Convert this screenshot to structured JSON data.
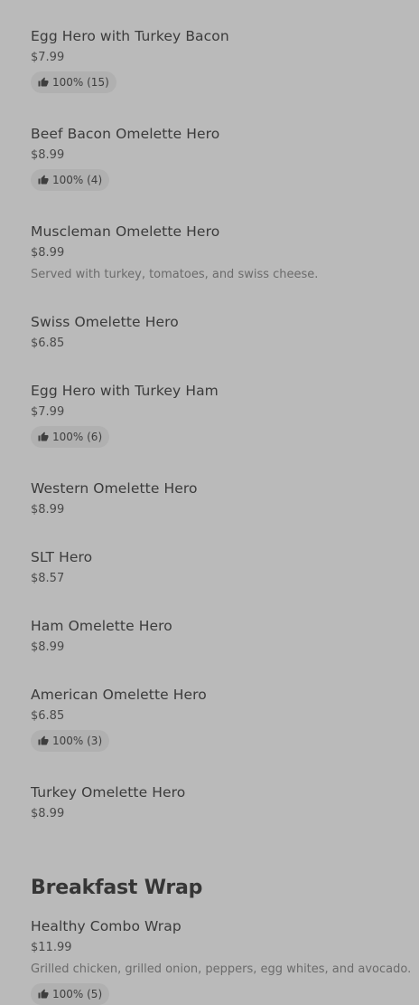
{
  "menu": {
    "section_title": "Breakfast Wrap",
    "items": [
      {
        "name": "Egg Hero with Turkey Bacon",
        "price": "$7.99",
        "rating": "100% (15)"
      },
      {
        "name": "Beef Bacon Omelette Hero",
        "price": "$8.99",
        "rating": "100% (4)"
      },
      {
        "name": "Muscleman Omelette Hero",
        "price": "$8.99",
        "description": "Served with turkey, tomatoes, and swiss cheese."
      },
      {
        "name": "Swiss Omelette Hero",
        "price": "$6.85"
      },
      {
        "name": "Egg Hero with Turkey Ham",
        "price": "$7.99",
        "rating": "100% (6)"
      },
      {
        "name": "Western Omelette Hero",
        "price": "$8.99"
      },
      {
        "name": "SLT Hero",
        "price": "$8.57"
      },
      {
        "name": "Ham Omelette Hero",
        "price": "$8.99"
      },
      {
        "name": "American Omelette Hero",
        "price": "$6.85",
        "rating": "100% (3)"
      },
      {
        "name": "Turkey Omelette Hero",
        "price": "$8.99"
      },
      {
        "name": "Healthy Combo Wrap",
        "price": "$11.99",
        "description": "Grilled chicken, grilled onion, peppers, egg whites, and avocado.",
        "rating": "100% (5)"
      }
    ]
  },
  "icons": {
    "rating": "thumbs-up-icon"
  },
  "colors": {
    "background": "#bababa",
    "rating_pill": "#b0b0b0",
    "text_primary": "#3b3b3b",
    "text_secondary": "#6b6b6b"
  }
}
